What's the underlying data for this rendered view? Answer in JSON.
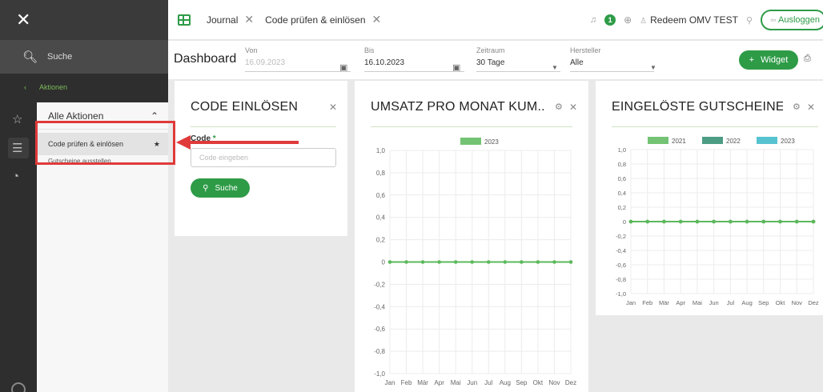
{
  "sidebar": {
    "close_icon": "✕",
    "search_label": "Suche",
    "breadcrumb_arrow": "‹",
    "breadcrumb": "Aktionen",
    "panel_title": "Alle Aktionen",
    "items": [
      {
        "label": "Code prüfen & einlösen",
        "starred": true
      },
      {
        "label": "Gutscheine ausstellen"
      }
    ]
  },
  "tabs": [
    {
      "label": "Journal"
    },
    {
      "label": "Code prüfen & einlösen"
    }
  ],
  "topbar": {
    "notification_count": "1",
    "user": "Redeem OMV TEST",
    "logout_label": "Ausloggen"
  },
  "filters": {
    "title": "Dashboard",
    "von_label": "Von",
    "von_value": "16.09.2023",
    "bis_label": "Bis",
    "bis_value": "16.10.2023",
    "zeitraum_label": "Zeitraum",
    "zeitraum_value": "30 Tage",
    "hersteller_label": "Hersteller",
    "hersteller_value": "Alle",
    "widget_label": "Widget",
    "widget_plus": "+"
  },
  "code_card": {
    "title": "CODE EINLÖSEN",
    "field_label": "Code",
    "required_mark": "*",
    "placeholder": "Code eingeben",
    "button_label": "Suche"
  },
  "chart1_title": "UMSATZ PRO MONAT KUM...",
  "chart2_title": "EINGELÖSTE GUTSCHEINE ...",
  "colors": {
    "accent": "#2e9b47",
    "line": "#5cb85c",
    "annotation": "#e03a3a"
  },
  "chart_data": [
    {
      "type": "line",
      "title": "UMSATZ PRO MONAT KUM...",
      "categories": [
        "Jan",
        "Feb",
        "Mär",
        "Apr",
        "Mai",
        "Jun",
        "Jul",
        "Aug",
        "Sep",
        "Okt",
        "Nov",
        "Dez"
      ],
      "ylim": [
        -1.0,
        1.0
      ],
      "yticks": [
        "1,0",
        "0,8",
        "0,6",
        "0,4",
        "0,2",
        "0",
        "-0,2",
        "-0,4",
        "-0,6",
        "-0,8",
        "-1,0"
      ],
      "series": [
        {
          "name": "2023",
          "color": "#5cb85c",
          "values": [
            0,
            0,
            0,
            0,
            0,
            0,
            0,
            0,
            0,
            0,
            0,
            0
          ]
        }
      ],
      "grid": true,
      "legend": "top-center"
    },
    {
      "type": "line",
      "title": "EINGELÖSTE GUTSCHEINE ...",
      "categories": [
        "Jan",
        "Feb",
        "Mär",
        "Apr",
        "Mai",
        "Jun",
        "Jul",
        "Aug",
        "Sep",
        "Okt",
        "Nov",
        "Dez"
      ],
      "ylim": [
        -1.0,
        1.0
      ],
      "yticks": [
        "1,0",
        "0,8",
        "0,6",
        "0,4",
        "0,2",
        "0",
        "-0,2",
        "-0,4",
        "-0,6",
        "-0,8",
        "-1,0"
      ],
      "series": [
        {
          "name": "2021",
          "color": "#5cb85c",
          "values": [
            0,
            0,
            0,
            0,
            0,
            0,
            0,
            0,
            0,
            0,
            0,
            0
          ]
        },
        {
          "name": "2022",
          "color": "#2e8b6e",
          "values": [
            0,
            0,
            0,
            0,
            0,
            0,
            0,
            0,
            0,
            0,
            0,
            0
          ]
        },
        {
          "name": "2023",
          "color": "#3bb8c8",
          "values": [
            0,
            0,
            0,
            0,
            0,
            0,
            0,
            0,
            0,
            0,
            0,
            0
          ]
        }
      ],
      "grid": true,
      "legend": "top-center"
    }
  ]
}
